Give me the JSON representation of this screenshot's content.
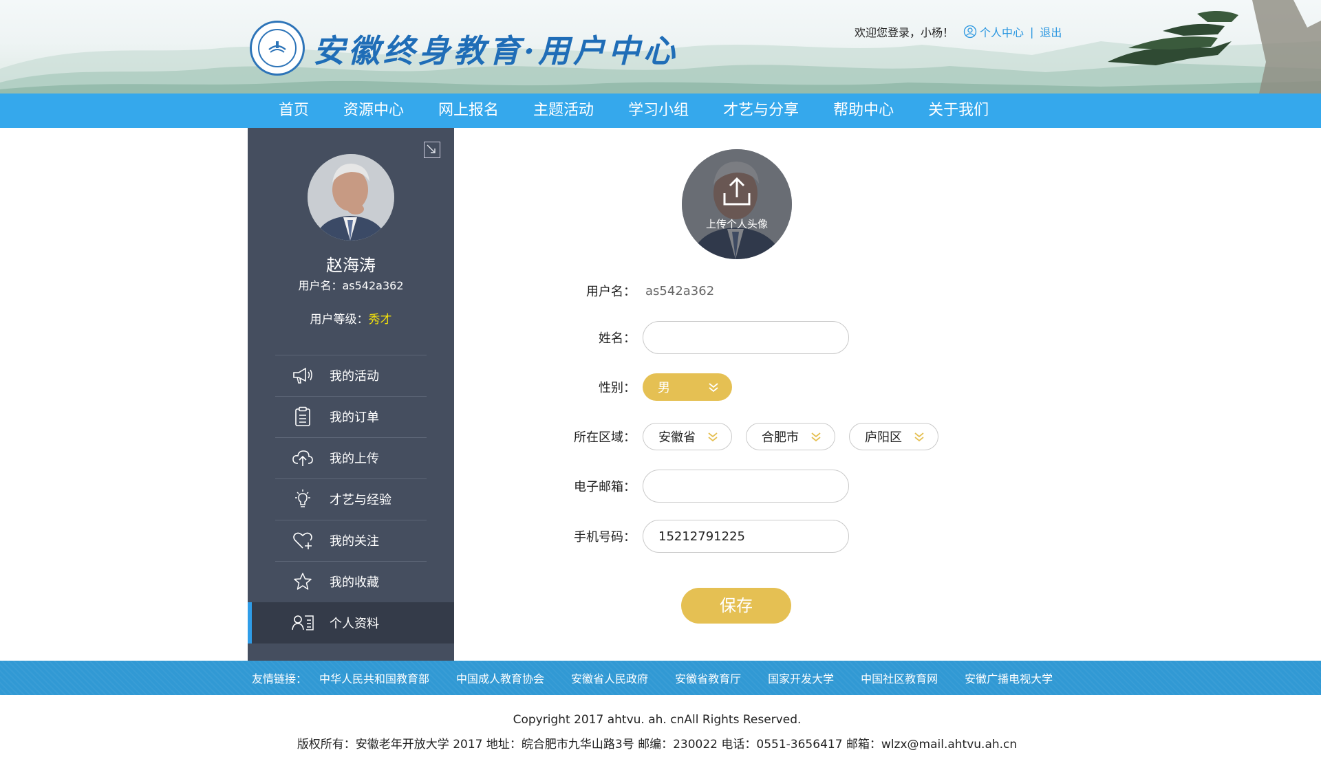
{
  "header": {
    "site_title": "安徽终身教育·用户中心",
    "welcome": "欢迎您登录，小杨！",
    "user_center_link": "个人中心",
    "separator": "|",
    "logout_link": "退出"
  },
  "nav": {
    "items": [
      "首页",
      "资源中心",
      "网上报名",
      "主题活动",
      "学习小组",
      "才艺与分享",
      "帮助中心",
      "关于我们"
    ]
  },
  "sidebar": {
    "name": "赵海涛",
    "username": "用户名：as542a362",
    "level_label": "用户等级：",
    "level_value": "秀才",
    "menu": [
      {
        "label": "我的活动",
        "icon": "megaphone-icon"
      },
      {
        "label": "我的订单",
        "icon": "clipboard-icon"
      },
      {
        "label": "我的上传",
        "icon": "cloud-upload-icon"
      },
      {
        "label": "才艺与经验",
        "icon": "lightbulb-icon"
      },
      {
        "label": "我的关注",
        "icon": "heart-plus-icon"
      },
      {
        "label": "我的收藏",
        "icon": "star-icon"
      },
      {
        "label": "个人资料",
        "icon": "profile-card-icon",
        "active": true
      }
    ]
  },
  "form": {
    "upload_avatar_label": "上传个人头像",
    "username_label": "用户名：",
    "username_value": "as542a362",
    "name_label": "姓名：",
    "name_value": "",
    "gender_label": "性别：",
    "gender_value": "男",
    "region_label": "所在区域：",
    "province": "安徽省",
    "city": "合肥市",
    "district": "庐阳区",
    "email_label": "电子邮箱：",
    "email_value": "",
    "phone_label": "手机号码：",
    "phone_value": "15212791225",
    "save_label": "保存"
  },
  "footer": {
    "links_label": "友情链接：",
    "links": [
      "中华人民共和国教育部",
      "中国成人教育协会",
      "安徽省人民政府",
      "安徽省教育厅",
      "国家开发大学",
      "中国社区教育网",
      "安徽广播电视大学"
    ],
    "copyright": "Copyright 2017 ahtvu. ah. cnAll Rights Reserved.",
    "address": "版权所有：安徽老年开放大学 2017 地址：皖合肥市九华山路3号 邮编：230022 电话：0551-3656417 邮箱：wlzx@mail.ahtvu.ah.cn"
  },
  "colors": {
    "nav_bg": "#35a8ec",
    "sidebar_bg": "#454e5f",
    "accent_gold": "#e5c053",
    "link_blue": "#2996e0",
    "level_yellow": "#f5e20a"
  }
}
